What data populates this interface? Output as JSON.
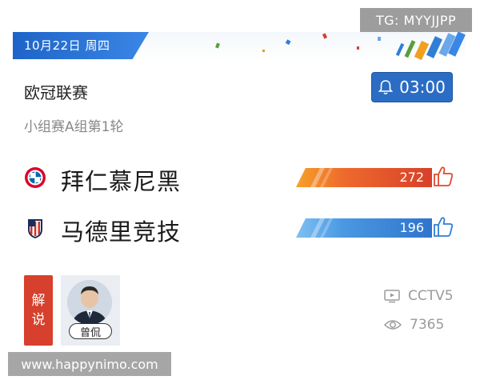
{
  "banner": {
    "date": "10月22日 周四"
  },
  "match": {
    "league": "欧冠联赛",
    "round": "小组赛A组第1轮",
    "reminder_time": "03:00"
  },
  "teams": [
    {
      "name": "拜仁慕尼黑",
      "votes": "272",
      "bar_color": "#e04a2c"
    },
    {
      "name": "马德里竞技",
      "votes": "196",
      "bar_color": "#2f7fd6"
    }
  ],
  "commentary": {
    "tag_chars": [
      "解",
      "说"
    ],
    "commentator_name": "曾侃"
  },
  "broadcast": {
    "channel": "CCTV5",
    "views": "7365"
  },
  "watermarks": {
    "top": "TG: MYYJJPP",
    "bottom": "www.happynimo.com"
  },
  "colors": {
    "accent": "#2b6cc4",
    "commentary_tag": "#d6402c",
    "muted": "#9a9a9a"
  }
}
